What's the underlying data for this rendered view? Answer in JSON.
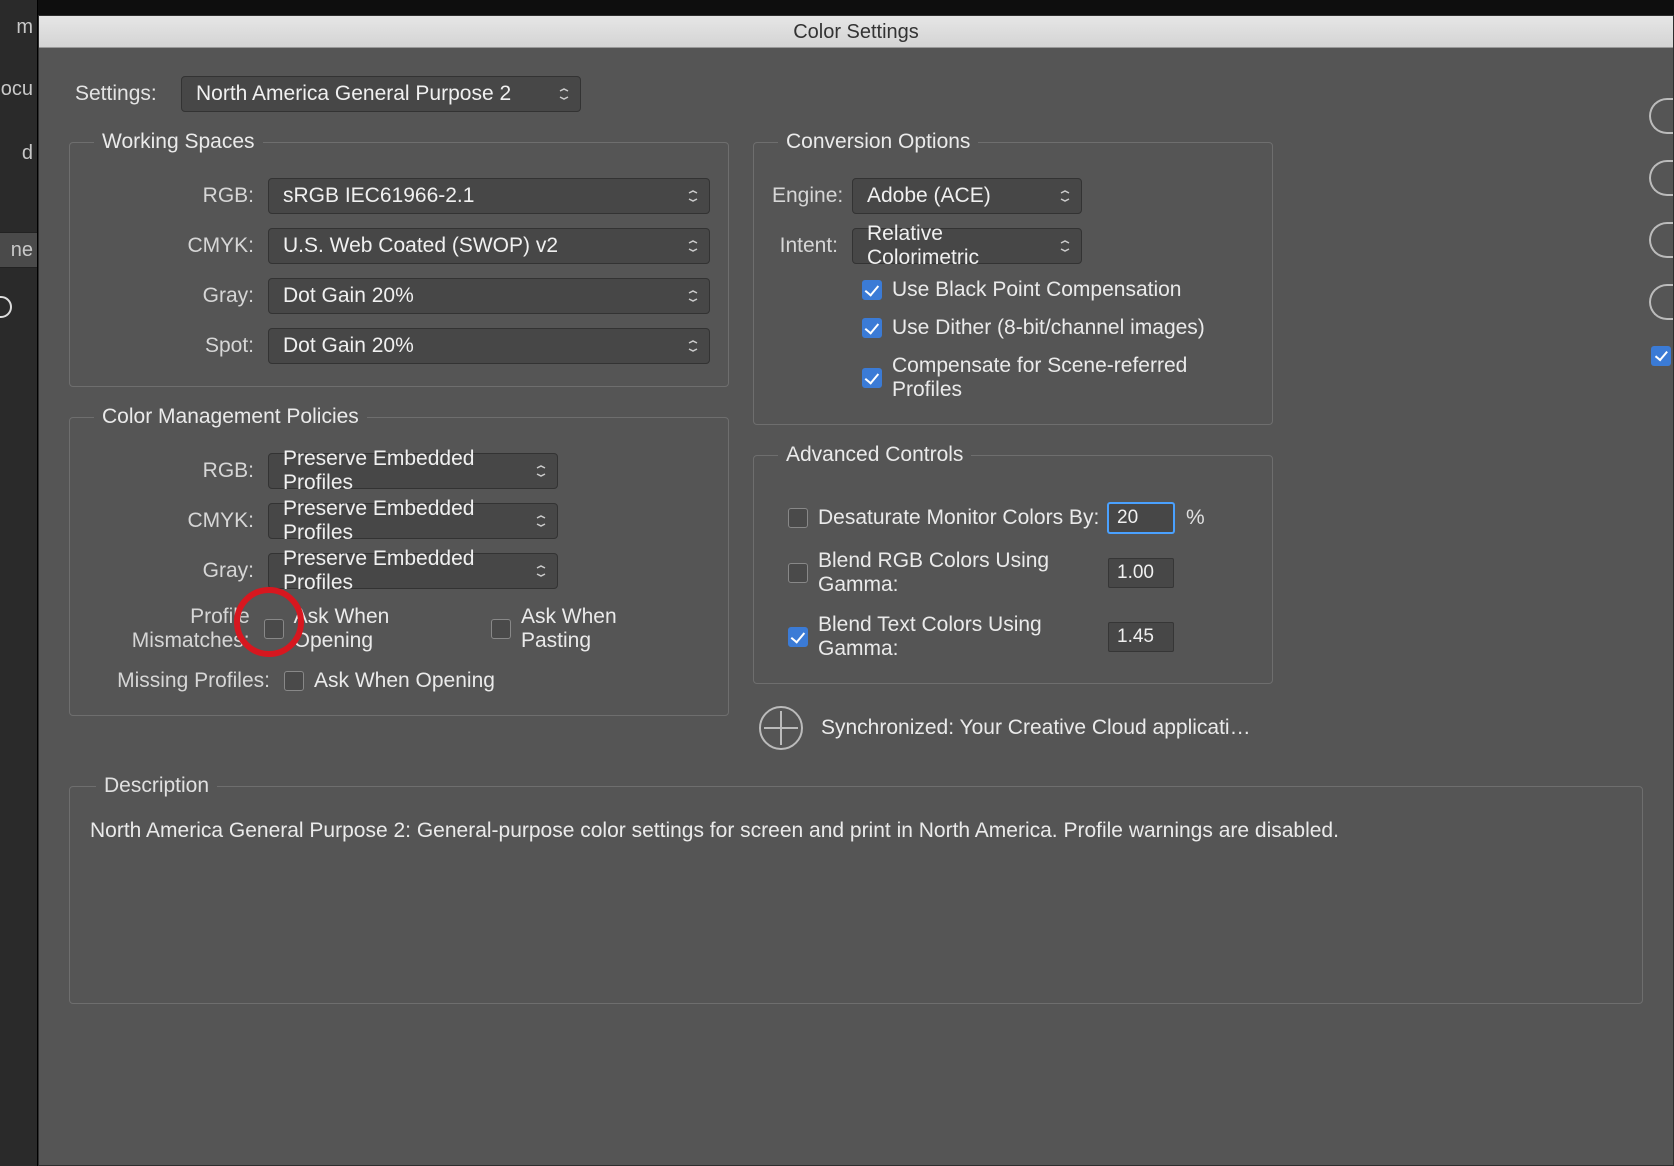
{
  "window": {
    "title": "Color Settings"
  },
  "leftStrip": {
    "frag1": "m",
    "frag2": "ocu",
    "frag3": "d",
    "frag4": "ne"
  },
  "settings": {
    "label": "Settings:",
    "value": "North America General Purpose 2"
  },
  "working": {
    "legend": "Working Spaces",
    "rgb": {
      "label": "RGB:",
      "value": "sRGB IEC61966-2.1"
    },
    "cmyk": {
      "label": "CMYK:",
      "value": "U.S. Web Coated (SWOP) v2"
    },
    "gray": {
      "label": "Gray:",
      "value": "Dot Gain 20%"
    },
    "spot": {
      "label": "Spot:",
      "value": "Dot Gain 20%"
    }
  },
  "policies": {
    "legend": "Color Management Policies",
    "rgb": {
      "label": "RGB:",
      "value": "Preserve Embedded Profiles"
    },
    "cmyk": {
      "label": "CMYK:",
      "value": "Preserve Embedded Profiles"
    },
    "gray": {
      "label": "Gray:",
      "value": "Preserve Embedded Profiles"
    },
    "mismatch_label": "Profile Mismatches:",
    "mismatch_open": "Ask When Opening",
    "mismatch_paste": "Ask When Pasting",
    "missing_label": "Missing Profiles:",
    "missing_open": "Ask When Opening"
  },
  "conversion": {
    "legend": "Conversion Options",
    "engine": {
      "label": "Engine:",
      "value": "Adobe (ACE)"
    },
    "intent": {
      "label": "Intent:",
      "value": "Relative Colorimetric"
    },
    "bpc": "Use Black Point Compensation",
    "dither": "Use Dither (8-bit/channel images)",
    "scene": "Compensate for Scene-referred Profiles"
  },
  "advanced": {
    "legend": "Advanced Controls",
    "desat": {
      "label": "Desaturate Monitor Colors By:",
      "value": "20",
      "unit": "%"
    },
    "blendrgb": {
      "label": "Blend RGB Colors Using Gamma:",
      "value": "1.00"
    },
    "blendtext": {
      "label": "Blend Text Colors Using Gamma:",
      "value": "1.45"
    }
  },
  "sync": {
    "text": "Synchronized: Your Creative Cloud applications ar..."
  },
  "description": {
    "legend": "Description",
    "text": "North America General Purpose 2:  General-purpose color settings for screen and print in North America. Profile warnings are disabled."
  }
}
